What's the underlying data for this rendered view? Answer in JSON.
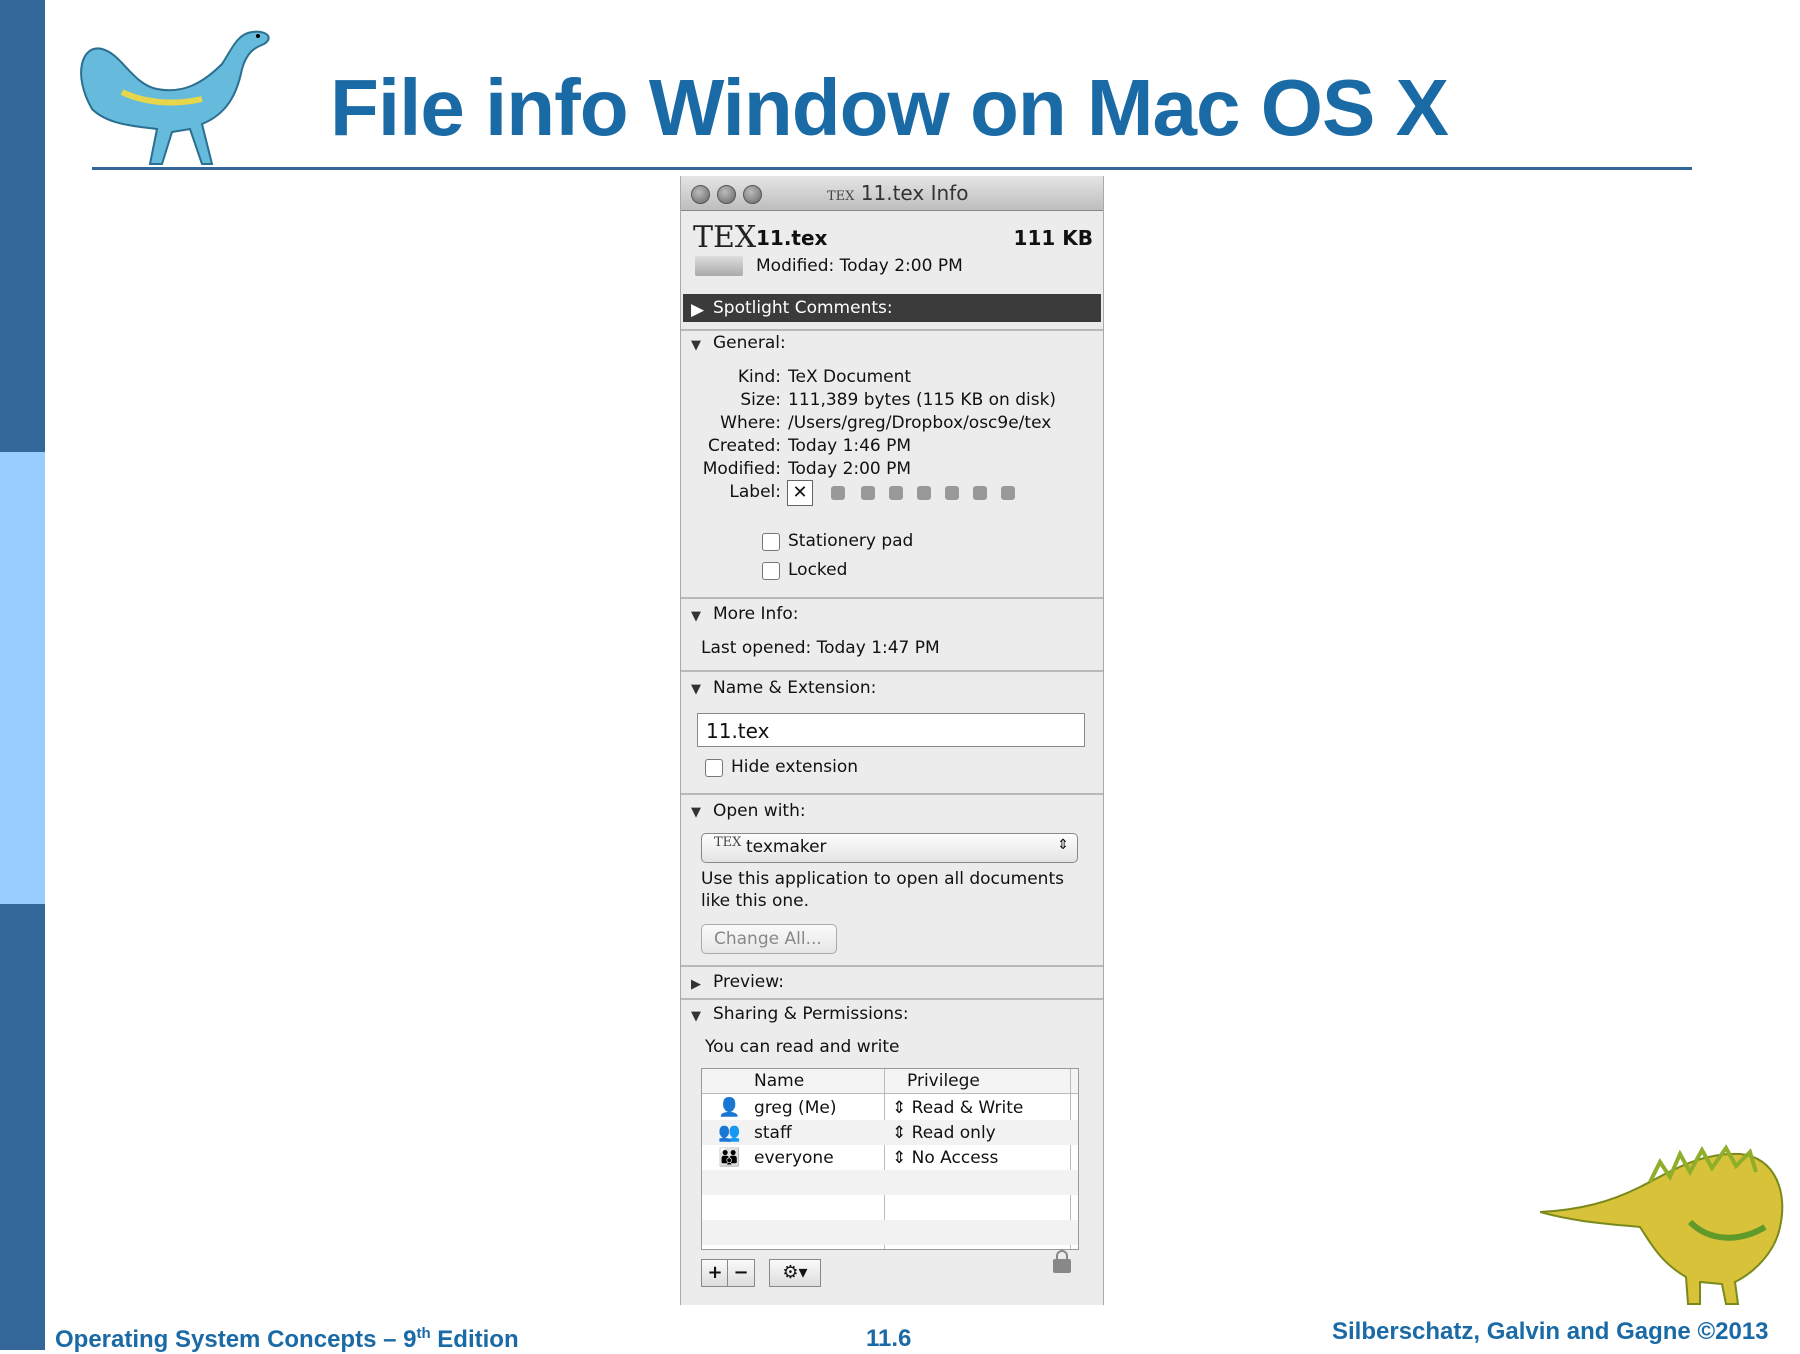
{
  "slide": {
    "title": "File info Window on Mac OS X",
    "footer_left": "Operating System  Concepts  – 9",
    "footer_left_sup": "th",
    "footer_left_suffix": " Edition",
    "footer_page": "11.6",
    "footer_right": "Silberschatz, Galvin and Gagne ©2013"
  },
  "window": {
    "title": "11.tex Info",
    "tex_mark": "TEX",
    "file_name": "11.tex",
    "file_size": "111 KB",
    "modified_summary": "Modified: Today 2:00 PM",
    "spotlight_label": "Spotlight Comments:",
    "general": {
      "label": "General:",
      "rows": [
        {
          "key": "Kind:",
          "value": "TeX Document"
        },
        {
          "key": "Size:",
          "value": "111,389 bytes (115 KB on disk)"
        },
        {
          "key": "Where:",
          "value": "/Users/greg/Dropbox/osc9e/tex"
        },
        {
          "key": "Created:",
          "value": "Today 1:46 PM"
        },
        {
          "key": "Modified:",
          "value": "Today 2:00 PM"
        }
      ],
      "label_key": "Label:",
      "label_clear": "✕",
      "stationery_label": "Stationery pad",
      "locked_label": "Locked"
    },
    "more_info": {
      "label": "More Info:",
      "last_opened": "Last opened: Today 1:47 PM"
    },
    "name_extension": {
      "label": "Name & Extension:",
      "field_value": "11.tex",
      "hide_extension_label": "Hide extension"
    },
    "open_with": {
      "label": "Open with:",
      "app": "texmaker",
      "description_line1": "Use this application to open all documents",
      "description_line2": "like this one.",
      "change_all_label": "Change All..."
    },
    "preview_label": "Preview:",
    "sharing": {
      "label": "Sharing & Permissions:",
      "summary": "You can read and write",
      "columns": [
        "Name",
        "Privilege"
      ],
      "rows": [
        {
          "name": "greg (Me)",
          "privilege": "Read & Write",
          "icon": "person-icon"
        },
        {
          "name": "staff",
          "privilege": "Read only",
          "icon": "group-icon"
        },
        {
          "name": "everyone",
          "privilege": "No Access",
          "icon": "everyone-icon"
        }
      ],
      "add_label": "+",
      "remove_label": "−",
      "gear_label": "⚙▾"
    }
  }
}
